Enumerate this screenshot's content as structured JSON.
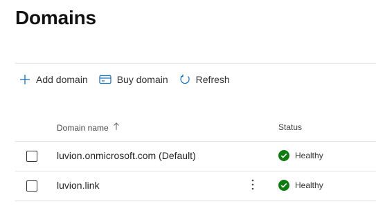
{
  "page": {
    "title": "Domains"
  },
  "toolbar": {
    "add_label": "Add domain",
    "buy_label": "Buy domain",
    "refresh_label": "Refresh"
  },
  "table": {
    "columns": {
      "name": "Domain name",
      "status": "Status"
    },
    "rows": [
      {
        "name": "luvion.onmicrosoft.com (Default)",
        "status": "Healthy"
      },
      {
        "name": "luvion.link",
        "status": "Healthy"
      }
    ]
  },
  "colors": {
    "accent": "#0f6cbd",
    "healthy": "#107c10"
  },
  "icons": [
    "add-icon",
    "buy-domain-icon",
    "refresh-icon",
    "sort-ascending-icon",
    "more-vertical-icon",
    "check-circle-icon"
  ]
}
